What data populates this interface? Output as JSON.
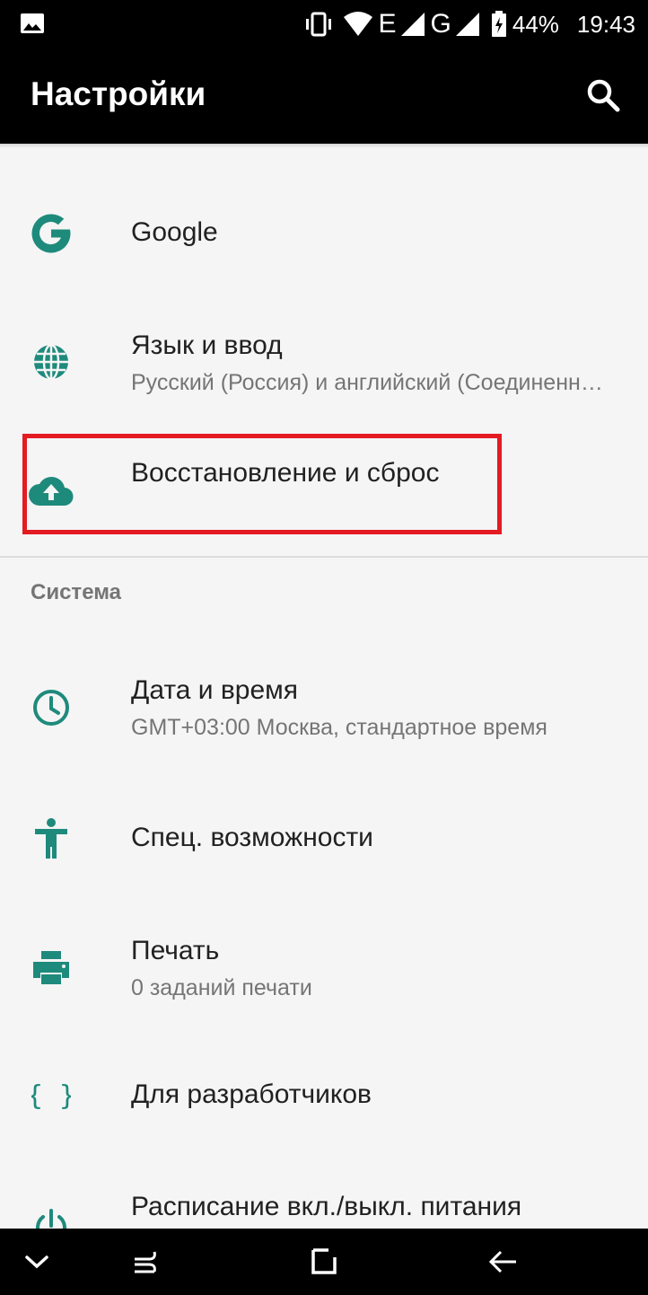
{
  "status_bar": {
    "network_1": "E",
    "network_2": "G",
    "battery": "44%",
    "time": "19:43",
    "icons": [
      "gallery-icon",
      "vibrate-icon",
      "wifi-icon",
      "signal-icon",
      "signal-icon",
      "battery-charging-icon"
    ]
  },
  "app_bar": {
    "title": "Настройки",
    "search_icon": "search-icon"
  },
  "items": [
    {
      "icon": "google-icon",
      "title": "Google"
    },
    {
      "icon": "globe-icon",
      "title": "Язык и ввод",
      "subtitle": "Русский (Россия) и английский (Соединенные Штаты)"
    },
    {
      "icon": "cloud-upload-icon",
      "title": "Восстановление и сброс"
    }
  ],
  "system_section": {
    "header": "Система",
    "items": [
      {
        "icon": "clock-icon",
        "title": "Дата и время",
        "subtitle": "GMT+03:00 Москва, стандартное время"
      },
      {
        "icon": "accessibility-icon",
        "title": "Спец. возможности"
      },
      {
        "icon": "printer-icon",
        "title": "Печать",
        "subtitle": "0 заданий печати"
      },
      {
        "icon": "braces-icon",
        "title": "Для разработчиков"
      },
      {
        "icon": "power-icon",
        "title": "Расписание вкл./выкл. питания"
      }
    ]
  },
  "nav_bar": {
    "buttons": [
      "chevron-down-icon",
      "recents-icon",
      "home-icon",
      "back-icon"
    ]
  },
  "colors": {
    "accent": "#1e8a7c",
    "highlight": "#e41b23",
    "bar": "#000000",
    "background": "#f5f5f5"
  }
}
